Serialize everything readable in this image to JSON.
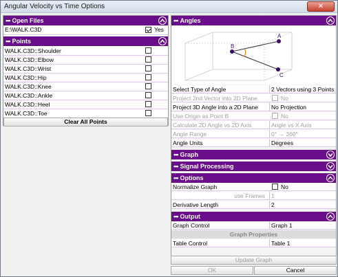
{
  "window": {
    "title": "Angular Velocity vs Time Options",
    "close_label": "✕"
  },
  "open_files": {
    "title": "Open Files",
    "rows": [
      {
        "file": "E:\\WALK.C3D",
        "checked": true,
        "label": "Yes"
      }
    ]
  },
  "points": {
    "title": "Points",
    "items": [
      "WALK.C3D::Shoulder",
      "WALK.C3D::Elbow",
      "WALK.C3D::Wrist",
      "WALK.C3D::Hip",
      "WALK.C3D::Knee",
      "WALK.C3D::Ankle",
      "WALK.C3D::Heel",
      "WALK.C3D::Toe"
    ],
    "clear_label": "Clear All Points"
  },
  "angles": {
    "title": "Angles",
    "diagram_labels": {
      "a": "A",
      "b": "B",
      "c": "C"
    },
    "rows": [
      {
        "label": "Select Type of Angle",
        "value": "2 Vectors using 3 Points"
      },
      {
        "label": "Project 2nd Vector into 2D Plane",
        "value": "No"
      },
      {
        "label": "Project 3D Angle into a 2D Plane",
        "value": "No Projection"
      },
      {
        "label": "Use Origin as Point B",
        "value": "No"
      },
      {
        "label": "Calculate 2D Angle vs 2D Axis",
        "value": "Angle vs X Axis"
      },
      {
        "label": "Angle Range",
        "value": "0° → 360°"
      },
      {
        "label": "Angle Units",
        "value": "Degrees"
      }
    ]
  },
  "graph": {
    "title": "Graph"
  },
  "signal_processing": {
    "title": "Signal Processing"
  },
  "options": {
    "title": "Options",
    "normalize_label": "Normalize Graph",
    "normalize_value": "No",
    "use_frames_label": "use Frames",
    "use_frames_value": "1",
    "derivative_label": "Derivative Length",
    "derivative_value": "2"
  },
  "output": {
    "title": "Output",
    "graph_control_label": "Graph Control",
    "graph_control_value": "Graph 1",
    "graph_properties_label": "Graph Properties",
    "table_control_label": "Table Control",
    "table_control_value": "Table 1"
  },
  "buttons": {
    "update_graph": "Update Graph",
    "ok": "OK",
    "cancel": "Cancel"
  },
  "colors": {
    "section_header": "#6a0d8c",
    "row_border": "#e0c8ea"
  },
  "icons": {
    "section_collapse": "chevron-up-icon",
    "section_expand": "chevron-down-icon"
  }
}
